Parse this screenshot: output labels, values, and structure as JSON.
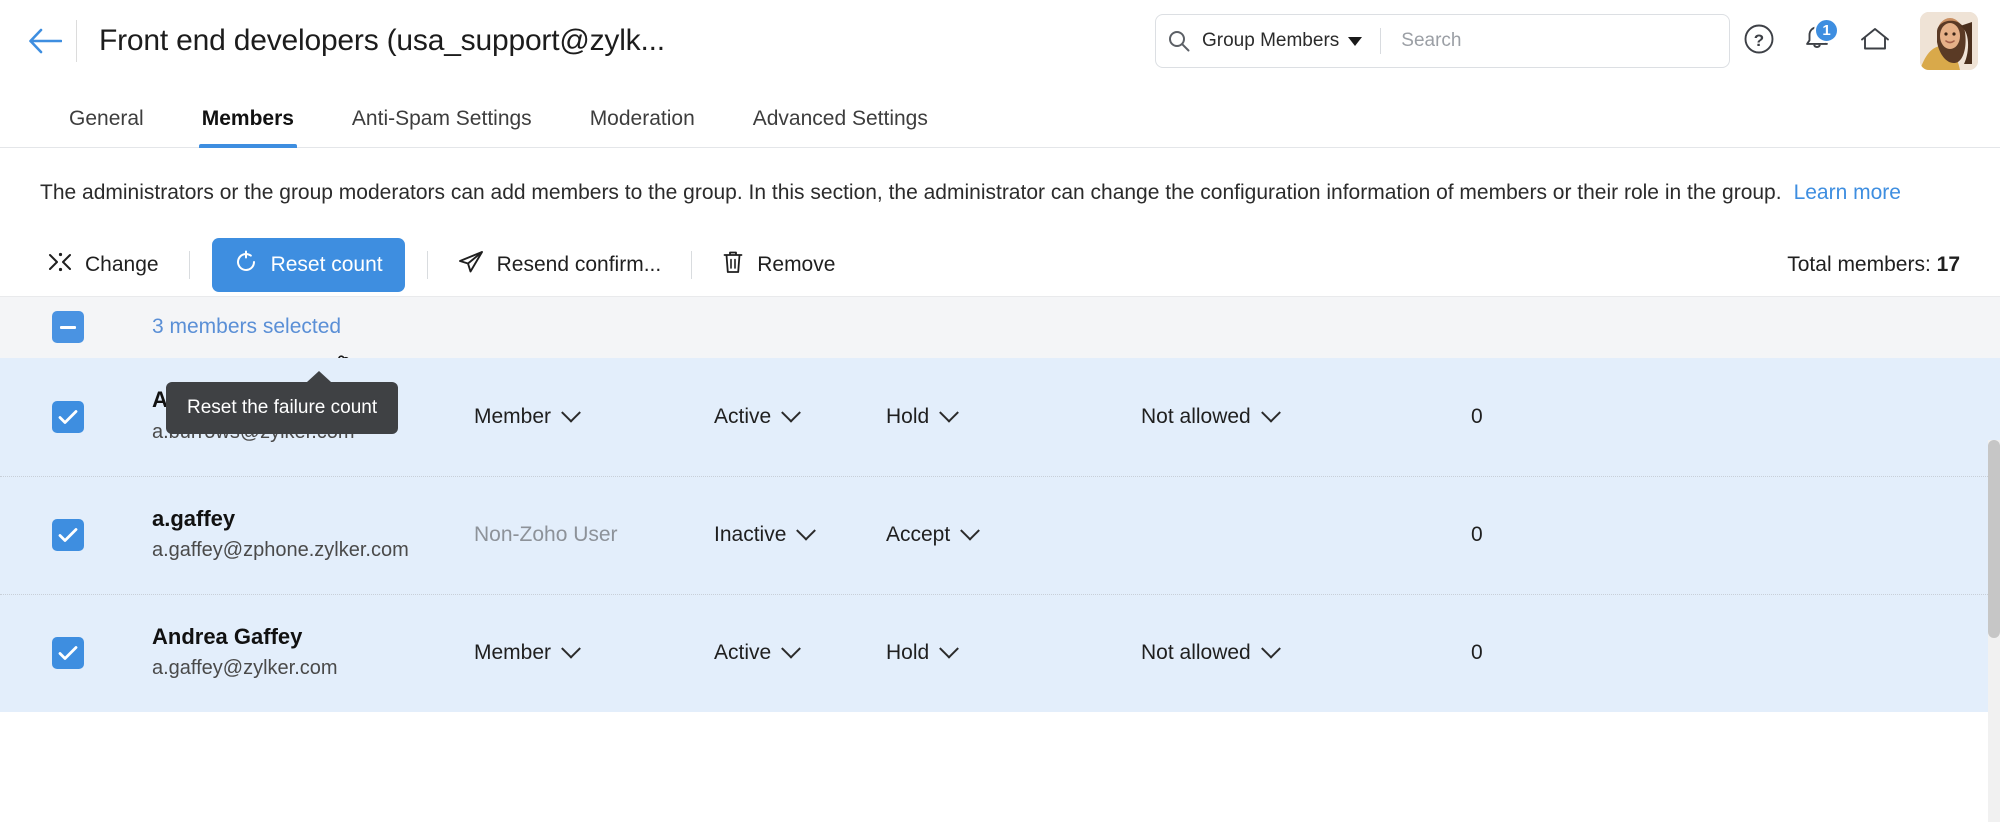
{
  "header": {
    "back_icon": "arrow-left-icon",
    "title": "Front end developers (usa_support@zylk...",
    "search": {
      "icon": "search-icon",
      "scope_label": "Group Members",
      "scope_caret": "chevron-down-icon",
      "placeholder": "Search",
      "value": ""
    },
    "help_icon": "question-circle-icon",
    "notification_icon": "bell-icon",
    "notification_badge": "1",
    "home_icon": "home-icon",
    "avatar": "user-avatar"
  },
  "tabs": [
    {
      "label": "General",
      "active": false
    },
    {
      "label": "Members",
      "active": true
    },
    {
      "label": "Anti-Spam Settings",
      "active": false
    },
    {
      "label": "Moderation",
      "active": false
    },
    {
      "label": "Advanced Settings",
      "active": false
    }
  ],
  "description": {
    "text": "The administrators or the group moderators can add members to the group. In this section, the administrator can change the configuration information of members or their role in the group.",
    "link_label": "Learn more"
  },
  "toolbar": {
    "change_label": "Change",
    "change_icon": "shuffle-icon",
    "reset_label": "Reset count",
    "reset_icon": "refresh-icon",
    "resend_label": "Resend confirm...",
    "resend_icon": "paper-plane-icon",
    "remove_label": "Remove",
    "remove_icon": "trash-icon",
    "total_label": "Total members:",
    "total_value": "17"
  },
  "tooltip": {
    "text": "Reset the failure count"
  },
  "selection_bar": {
    "checkbox_state": "indeterminate",
    "label": "3 members selected"
  },
  "rows": [
    {
      "checked": true,
      "name": "Amelia Burrows",
      "email": "a.burrows@zylker.com",
      "role": "Member",
      "role_muted": false,
      "status": "Active",
      "status_has_caret": true,
      "mode": "Hold",
      "mode_has_caret": true,
      "moderation": "Not allowed",
      "moderation_has_caret": true,
      "count": "0"
    },
    {
      "checked": true,
      "name": "a.gaffey",
      "email": "a.gaffey@zphone.zylker.com",
      "role": "Non-Zoho User",
      "role_muted": true,
      "status": "Inactive",
      "status_has_caret": true,
      "mode": "Accept",
      "mode_has_caret": true,
      "moderation": "",
      "moderation_has_caret": false,
      "count": "0"
    },
    {
      "checked": true,
      "name": "Andrea Gaffey",
      "email": "a.gaffey@zylker.com",
      "role": "Member",
      "role_muted": false,
      "status": "Active",
      "status_has_caret": true,
      "mode": "Hold",
      "mode_has_caret": true,
      "moderation": "Not allowed",
      "moderation_has_caret": true,
      "count": "0"
    }
  ],
  "colors": {
    "accent": "#3e8ee0",
    "row_selected_bg": "#e3eefb",
    "tooltip_bg": "#3f4144",
    "link": "#3e8ee0"
  }
}
